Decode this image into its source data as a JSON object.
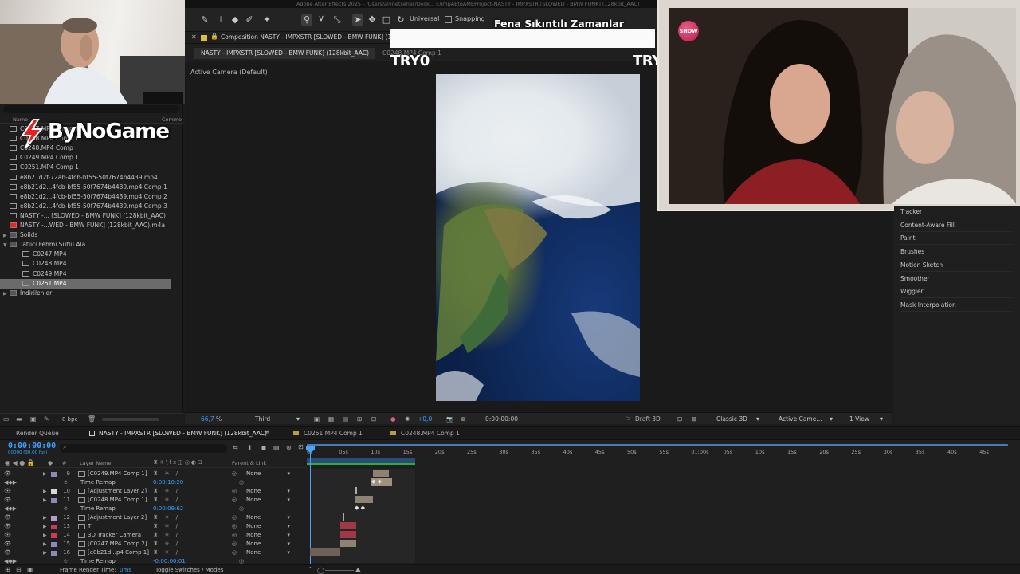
{
  "window": {
    "title": "Adobe After Effects 2025 - /Users/alvnetsener/Desk... E/impAEtoAMEProject-NASTY - IMPXSTR [SLOWED - BMW FUNK] (128kbit_AAC)"
  },
  "toolbar": {
    "universal_label": "Universal",
    "snapping_label": "Snapping"
  },
  "stream_overlay": {
    "logo_text": "ByNoGame",
    "title": "Fena Sıkıntılı Zamanlar",
    "ticker_left": "TRY0",
    "ticker_right": "TRY",
    "tv_badge": "SHOW"
  },
  "project": {
    "col_name": "Name",
    "col_comment": "Comme",
    "items": [
      {
        "label": "C0247.MP4 Comp 1",
        "type": "comp",
        "indent": 0
      },
      {
        "label": "C0248.MP4 Comp 1",
        "type": "comp",
        "indent": 0
      },
      {
        "label": "C0248.MP4 Comp",
        "type": "comp",
        "indent": 0
      },
      {
        "label": "C0249.MP4 Comp 1",
        "type": "comp",
        "indent": 0
      },
      {
        "label": "C0251.MP4 Comp 1",
        "type": "comp",
        "indent": 0
      },
      {
        "label": "e8b21d2f-72ab-4fcb-bf55-50f7674b4439.mp4",
        "type": "footage",
        "indent": 0
      },
      {
        "label": "e8b21d2...4fcb-bf55-50f7674b4439.mp4 Comp 1",
        "type": "comp",
        "indent": 0
      },
      {
        "label": "e8b21d2...4fcb-bf55-50f7674b4439.mp4 Comp 2",
        "type": "comp",
        "indent": 0
      },
      {
        "label": "e8b21d2...4fcb-bf55-50f7674b4439.mp4 Comp 3",
        "type": "comp",
        "indent": 0
      },
      {
        "label": "NASTY -... [SLOWED - BMW FUNK] (128kbit_AAC)",
        "type": "comp",
        "indent": 0
      },
      {
        "label": "NASTY -...WED - BMW FUNK] (128kbit_AAC).m4a",
        "type": "audio",
        "indent": 0
      },
      {
        "label": "Solids",
        "type": "folder",
        "indent": 0
      },
      {
        "label": "Tatlıcı Fehmi Sütlü Ala",
        "type": "folder",
        "indent": 0
      },
      {
        "label": "C0247.MP4",
        "type": "footage",
        "indent": 1
      },
      {
        "label": "C0248.MP4",
        "type": "footage",
        "indent": 1
      },
      {
        "label": "C0249.MP4",
        "type": "footage",
        "indent": 1
      },
      {
        "label": "C0251.MP4",
        "type": "footage",
        "indent": 1,
        "selected": true
      },
      {
        "label": "İndirilenler",
        "type": "folder",
        "indent": 0
      }
    ],
    "bpc": "8 bpc"
  },
  "composition": {
    "tab_label": "Composition NASTY - IMPXSTR [SLOWED - BMW FUNK] (128",
    "subtab_active": "NASTY - IMPXSTR [SLOWED - BMW FUNK] (128kbit_AAC)",
    "subtab_2": "C0248.MP4 Comp 1",
    "active_camera": "Active Camera (Default)",
    "zoom": "66,7",
    "zoom_unit": "%",
    "resolution": "Third",
    "exposure": "+0,0",
    "timecode": "0:00:00:00",
    "draft_3d": "Draft 3D",
    "renderer": "Classic 3D",
    "view_camera": "Active Came...",
    "views": "1 View"
  },
  "effects_panel": {
    "items": [
      "Tracker",
      "Content-Aware Fill",
      "Paint",
      "Brushes",
      "Motion Sketch",
      "Smoother",
      "Wiggler",
      "Mask Interpolation"
    ]
  },
  "timeline": {
    "tabs": [
      "Render Queue",
      "NASTY - IMPXSTR [SLOWED - BMW FUNK] (128kbit_AAC)",
      "C0251.MP4 Comp 1",
      "C0248.MP4 Comp 1"
    ],
    "current_time": "0:00:00:00",
    "current_time_sub": "00000 (30.00 fps)",
    "col_layer_name": "Layer Name",
    "col_parent": "Parent & Link",
    "col_number": "#",
    "ruler_ticks": [
      "0s",
      "05s",
      "10s",
      "15s",
      "20s",
      "25s",
      "30s",
      "35s",
      "40s",
      "45s",
      "50s",
      "55s",
      "01:00s",
      "05s",
      "10s",
      "15s",
      "20s",
      "25s",
      "30s",
      "35s",
      "40s",
      "45s"
    ],
    "layers": [
      {
        "num": "9",
        "name": "[C0249.MP4 Comp 1]",
        "parent": "None",
        "color": "#8a8ab8"
      },
      {
        "sub": "Time Remap",
        "value": "0:00:10:20"
      },
      {
        "num": "10",
        "name": "[Adjustment Layer 2]",
        "parent": "None",
        "color": "#d8d8d8"
      },
      {
        "num": "11",
        "name": "[C0248.MP4 Comp 1]",
        "parent": "None",
        "color": "#8a8ab8"
      },
      {
        "sub": "Time Remap",
        "value": "0:00:09:62"
      },
      {
        "num": "12",
        "name": "[Adjustment Layer 2]",
        "parent": "None",
        "color": "#b89ac8"
      },
      {
        "num": "13",
        "name": "T",
        "parent": "None",
        "color": "#c83c5a"
      },
      {
        "num": "14",
        "name": "3D Tracker Camera",
        "parent": "None",
        "color": "#c83c5a"
      },
      {
        "num": "15",
        "name": "[C0247.MP4 Comp 2]",
        "parent": "None",
        "color": "#8a8ab8"
      },
      {
        "num": "16",
        "name": "[e8b21d...p4 Comp 1]",
        "parent": "None",
        "color": "#8a8ab8"
      },
      {
        "sub": "Time Remap",
        "value": "-0:00:00:01"
      }
    ],
    "frame_render_label": "Frame Render Time:",
    "frame_render_value": "0ms",
    "toggle_label": "Toggle Switches / Modes"
  }
}
